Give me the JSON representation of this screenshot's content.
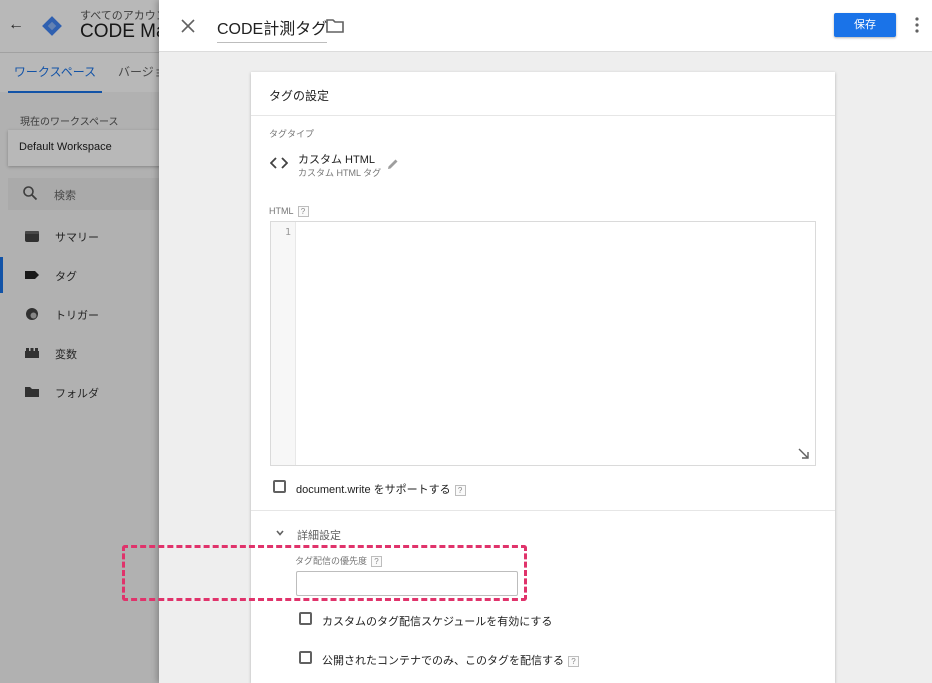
{
  "background": {
    "breadcrumb": "すべてのアカウント >",
    "container_name": "CODE Ma",
    "tabs": [
      {
        "label": "ワークスペース"
      },
      {
        "label": "バージョン"
      }
    ],
    "workspace_label": "現在のワークスペース",
    "workspace_name": "Default Workspace",
    "search_text": "検索",
    "nav": [
      {
        "label": "サマリー",
        "icon": "summary-icon"
      },
      {
        "label": "タグ",
        "icon": "tag-icon"
      },
      {
        "label": "トリガー",
        "icon": "trigger-icon"
      },
      {
        "label": "変数",
        "icon": "variable-icon"
      },
      {
        "label": "フォルダ",
        "icon": "folder-icon"
      }
    ]
  },
  "header": {
    "tag_name": "CODE計測タグ",
    "save_label": "保存"
  },
  "card": {
    "title": "タグの設定",
    "tag_type_label": "タグタイプ",
    "tag_type_name": "カスタム HTML",
    "tag_type_sub": "カスタム HTML タグ",
    "html_label": "HTML",
    "help_mark": "?",
    "line_number": "1",
    "document_write_label": "document.write をサポートする",
    "advanced_label": "詳細設定",
    "priority_label": "タグ配信の優先度",
    "priority_value": "",
    "schedule_label": "カスタムのタグ配信スケジュールを有効にする",
    "published_only_label": "公開されたコンテナでのみ、このタグを配信する"
  },
  "colors": {
    "accent": "#1a73e8",
    "highlight": "#e0336b"
  }
}
